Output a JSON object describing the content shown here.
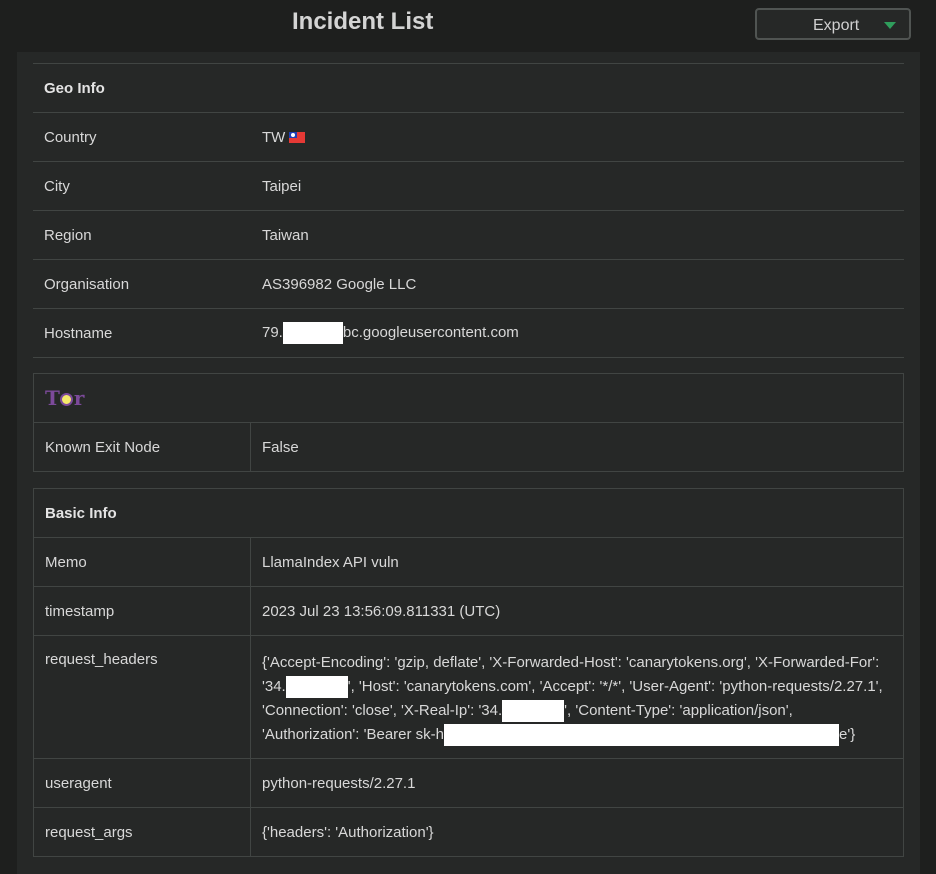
{
  "header": {
    "title": "Incident List",
    "export_label": "Export"
  },
  "geo": {
    "heading": "Geo Info",
    "rows": [
      {
        "key": "Country",
        "value": "TW"
      },
      {
        "key": "City",
        "value": "Taipei"
      },
      {
        "key": "Region",
        "value": "Taiwan"
      },
      {
        "key": "Organisation",
        "value": "AS396982 Google LLC"
      },
      {
        "key": "Hostname",
        "value_prefix": "79.",
        "value_suffix": "bc.googleusercontent.com"
      }
    ],
    "country_flag_icon": "taiwan-flag-icon"
  },
  "tor": {
    "logo_icon": "tor-logo-icon",
    "rows": [
      {
        "key": "Known Exit Node",
        "value": "False"
      }
    ]
  },
  "basic": {
    "heading": "Basic Info",
    "memo": {
      "key": "Memo",
      "value": "LlamaIndex API vuln"
    },
    "timestamp": {
      "key": "timestamp",
      "value": "2023 Jul 23 13:56:09.811331 (UTC)"
    },
    "request_headers": {
      "key": "request_headers",
      "part1": "{'Accept-Encoding': 'gzip, deflate', 'X-Forwarded-Host': 'canarytokens.org', 'X-Forwarded-For': '34.",
      "part2": "', 'Host': 'canarytokens.com', 'Accept': '*/*', 'User-Agent': 'python-requests/2.27.1', 'Connection': 'close', 'X-Real-Ip': '34.",
      "part3": "', 'Content-Type': 'application/json', 'Authorization': 'Bearer sk-h",
      "part4": "e'}"
    },
    "useragent": {
      "key": "useragent",
      "value": "python-requests/2.27.1"
    },
    "request_args": {
      "key": "request_args",
      "value": "{'headers': 'Authorization'}"
    }
  }
}
